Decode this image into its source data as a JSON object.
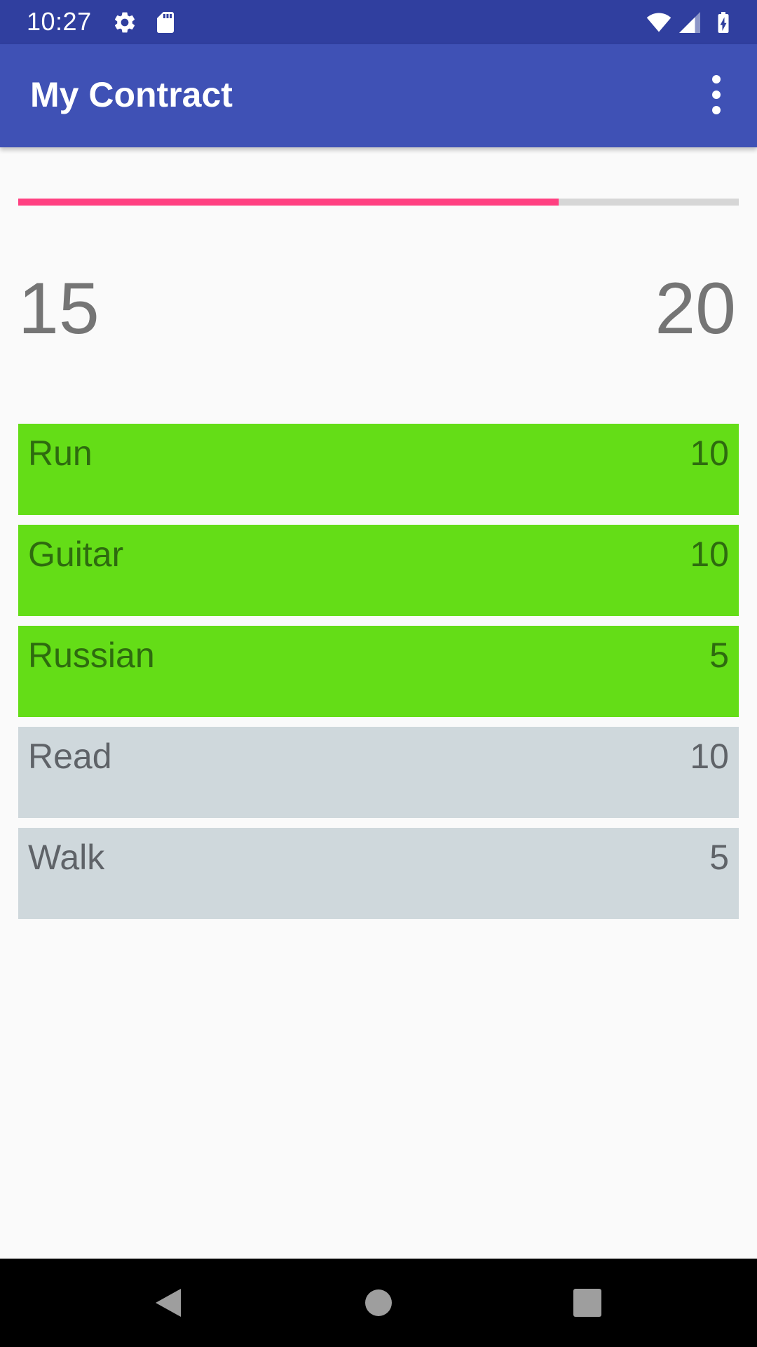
{
  "status_bar": {
    "time": "10:27",
    "icons": [
      "settings-icon",
      "sd-card-icon",
      "wifi-icon",
      "signal-icon",
      "battery-charging-icon"
    ],
    "color": "#303f9f"
  },
  "app_bar": {
    "title": "My Contract",
    "menu_icon": "more-vert-icon",
    "color": "#3f51b5"
  },
  "progress": {
    "value": 15,
    "max": 20,
    "fraction": 0.75,
    "current_label": "15",
    "target_label": "20",
    "fill_color": "#ff4081",
    "track_color": "#d6d6d6"
  },
  "tasks": [
    {
      "label": "Run",
      "points": "10",
      "completed": true
    },
    {
      "label": "Guitar",
      "points": "10",
      "completed": true
    },
    {
      "label": "Russian",
      "points": "5",
      "completed": true
    },
    {
      "label": "Read",
      "points": "10",
      "completed": false
    },
    {
      "label": "Walk",
      "points": "5",
      "completed": false
    }
  ],
  "colors": {
    "completed": "#64dd17",
    "pending": "#cfd8dc"
  },
  "nav_bar": {
    "buttons": [
      "back-icon",
      "home-icon",
      "recents-icon"
    ]
  }
}
